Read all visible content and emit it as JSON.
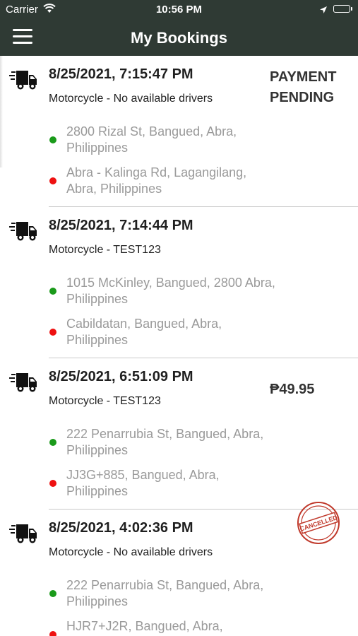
{
  "status_bar": {
    "carrier": "Carrier",
    "time": "10:56 PM"
  },
  "header": {
    "title": "My Bookings",
    "menu_icon": "hamburger-menu-icon"
  },
  "colors": {
    "header_bg": "#2f3a34",
    "pickup_dot": "#1a9a1a",
    "dropoff_dot": "#ee1111",
    "address_text": "#9a9a9a",
    "cancelled_stamp": "#c0392b"
  },
  "bookings": [
    {
      "datetime": "8/25/2021, 7:15:47 PM",
      "vehicle": "Motorcycle - No available drivers",
      "pickup": "2800 Rizal St, Bangued, Abra, Philippines",
      "dropoff": "Abra - Kalinga Rd, Lagangilang, Abra, Philippines",
      "status": "PAYMENT PENDING",
      "price": ""
    },
    {
      "datetime": "8/25/2021, 7:14:44 PM",
      "vehicle": "Motorcycle - TEST123",
      "pickup": "1015 McKinley, Bangued, 2800 Abra, Philippines",
      "dropoff": "Cabildatan, Bangued, Abra, Philippines",
      "status": "",
      "price": ""
    },
    {
      "datetime": "8/25/2021, 6:51:09 PM",
      "vehicle": "Motorcycle - TEST123",
      "pickup": "222 Penarrubia St, Bangued, Abra, Philippines",
      "dropoff": "JJ3G+885, Bangued, Abra, Philippines",
      "status": "",
      "price": "₱49.95"
    },
    {
      "datetime": "8/25/2021, 4:02:36 PM",
      "vehicle": "Motorcycle - No available drivers",
      "pickup": "222 Penarrubia St, Bangued, Abra, Philippines",
      "dropoff": "HJR7+J2R, Bangued, Abra,",
      "status": "",
      "price": "",
      "stamp": "CANCELLED"
    }
  ]
}
